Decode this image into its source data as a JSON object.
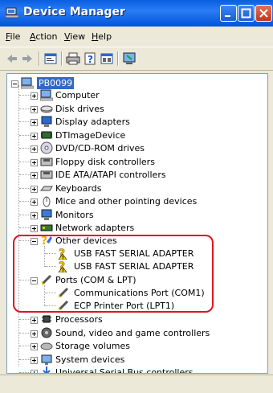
{
  "window": {
    "title": "Device Manager",
    "title_color": "#0a5fe0"
  },
  "menu": {
    "items": [
      {
        "label": "File",
        "accel": "F"
      },
      {
        "label": "Action",
        "accel": "A"
      },
      {
        "label": "View",
        "accel": "V"
      },
      {
        "label": "Help",
        "accel": "H"
      }
    ]
  },
  "toolbar": {
    "icons": [
      "back-icon",
      "forward-icon",
      "properties-icon",
      "print-icon",
      "help-icon",
      "show-view-icon",
      "update-driver-icon"
    ]
  },
  "tree": {
    "root": "PB0099",
    "categories": [
      "Computer",
      "Disk drives",
      "Display adapters",
      "DTImageDevice",
      "DVD/CD-ROM drives",
      "Floppy disk controllers",
      "IDE ATA/ATAPI controllers",
      "Keyboards",
      "Mice and other pointing devices",
      "Monitors",
      "Network adapters"
    ],
    "other_devices": {
      "label": "Other devices",
      "children": [
        "USB FAST SERIAL ADAPTER",
        "USB FAST SERIAL ADAPTER"
      ]
    },
    "ports": {
      "label": "Ports (COM & LPT)",
      "children": [
        "Communications Port (COM1)",
        "ECP Printer Port (LPT1)"
      ]
    },
    "after": [
      "Processors",
      "Sound, video and game controllers",
      "Storage volumes",
      "System devices",
      "Universal Serial Bus controllers"
    ]
  },
  "colors": {
    "highlight_border": "#e0141c",
    "selection": "#316ac5"
  }
}
